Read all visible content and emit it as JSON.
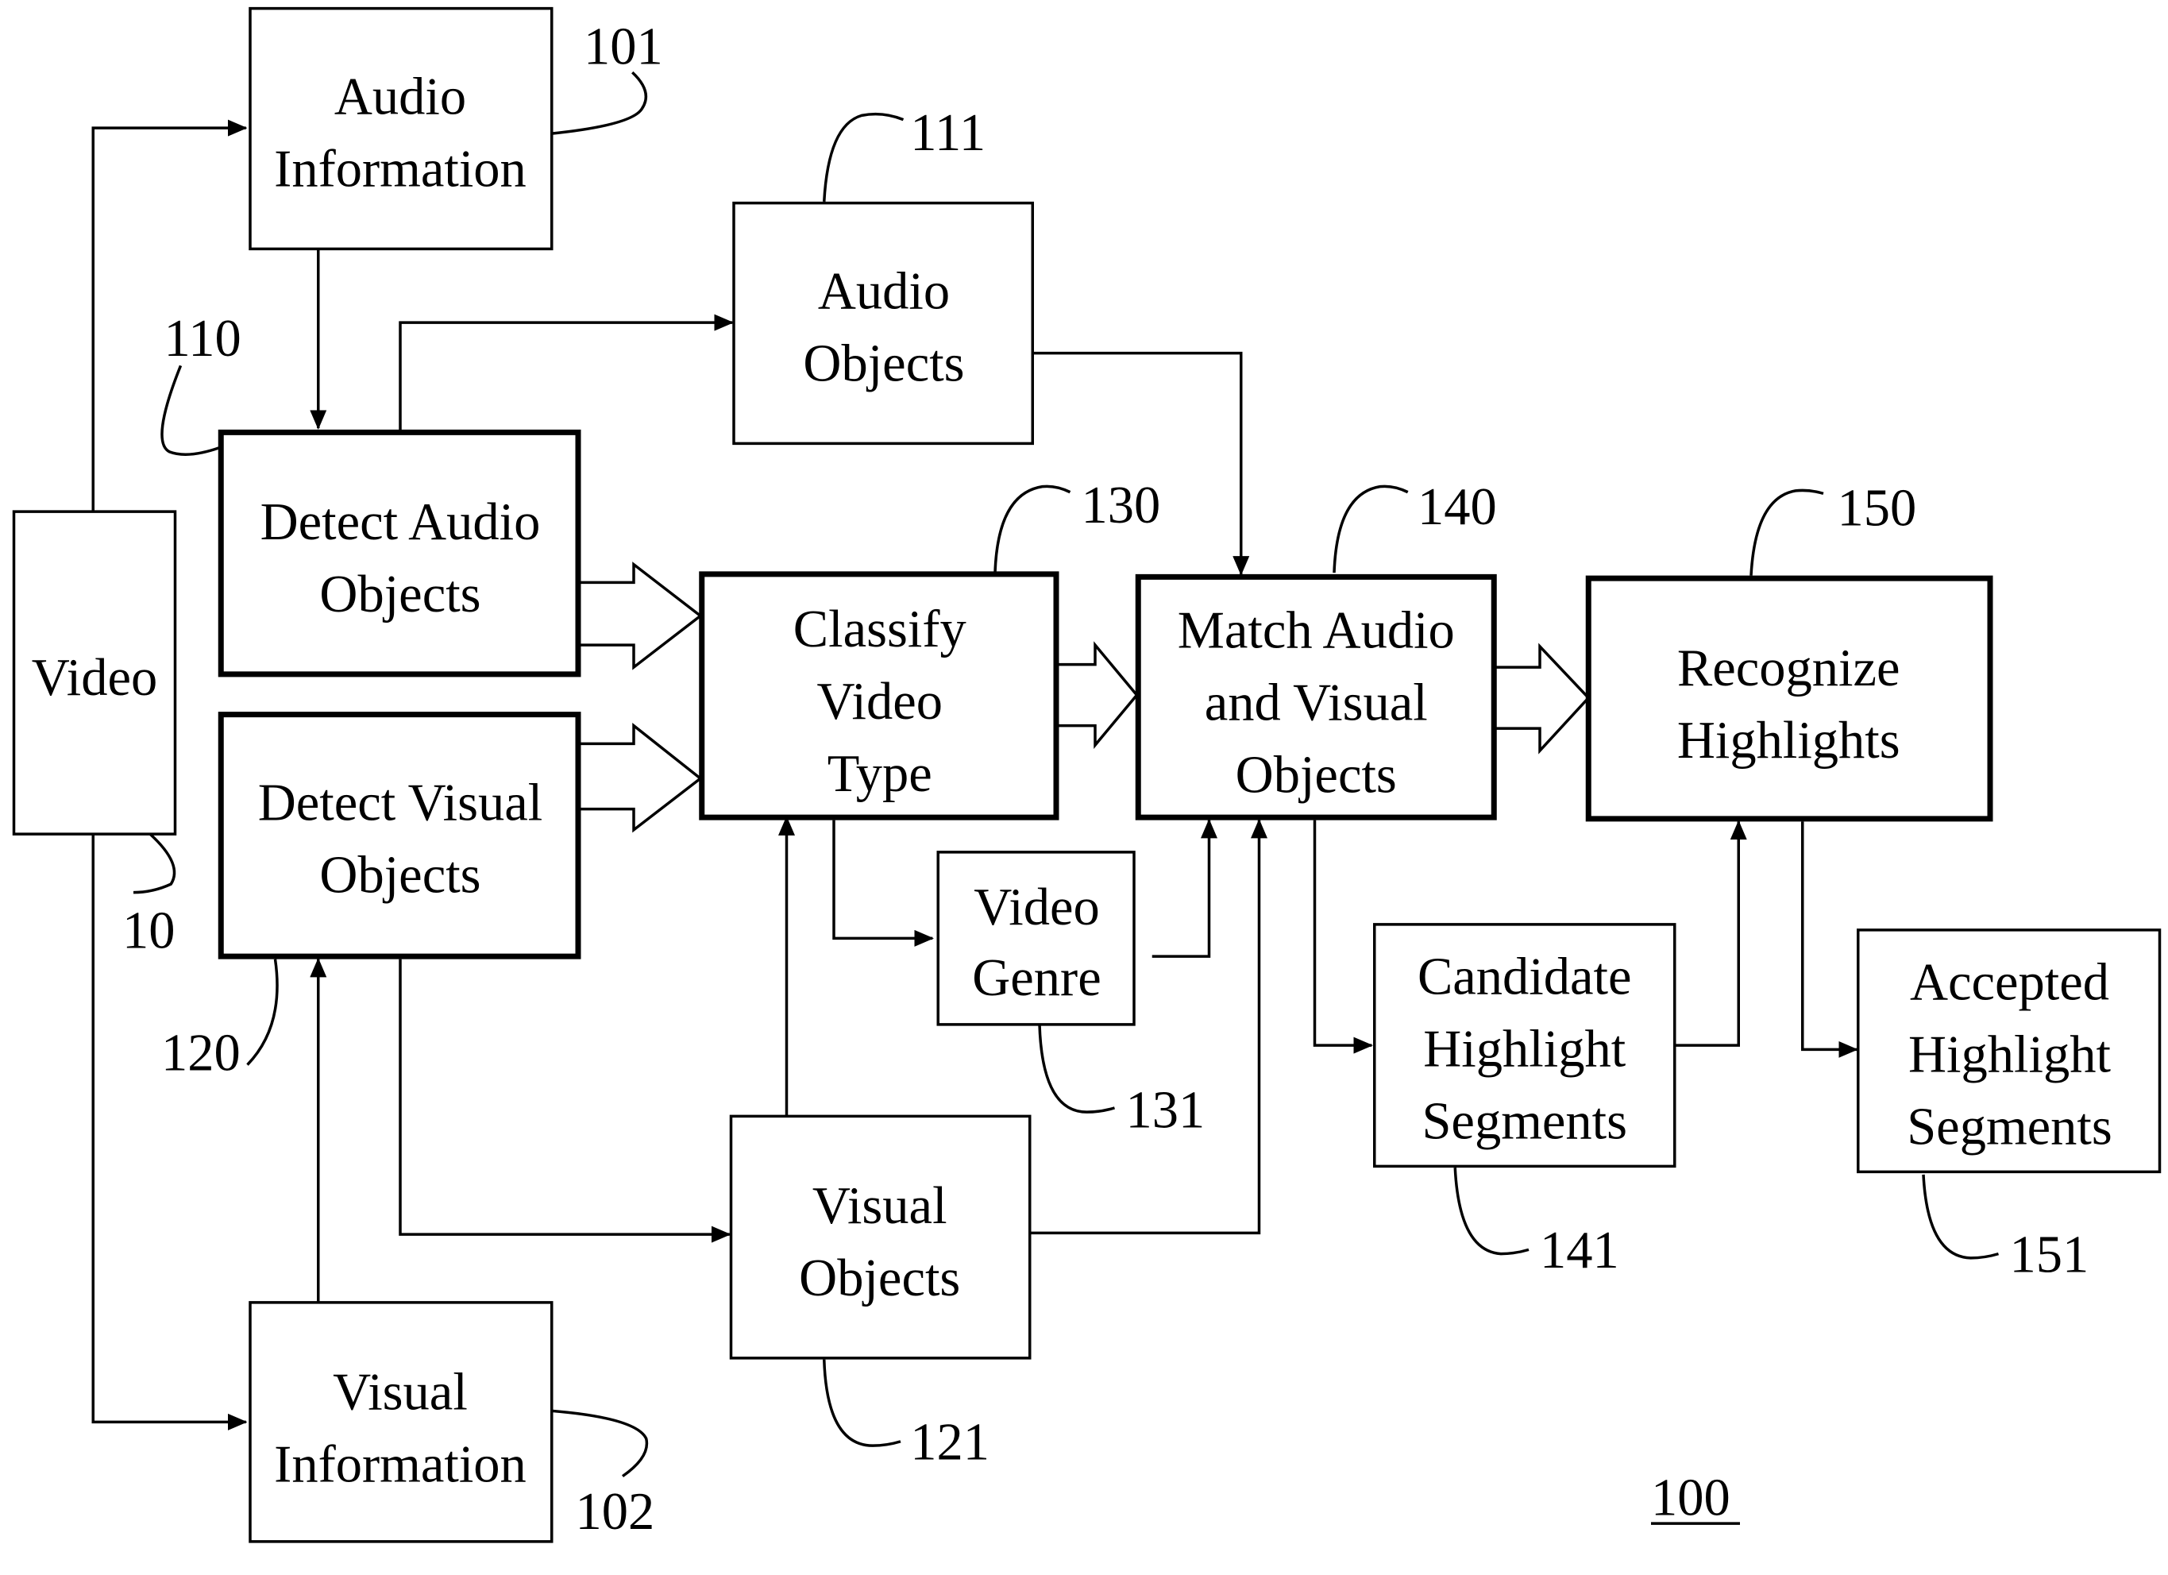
{
  "figure_number": "100",
  "nodes": {
    "video": {
      "lines": [
        "Video"
      ],
      "ref": "10"
    },
    "audio_information": {
      "lines": [
        "Audio",
        "Information"
      ],
      "ref": "101"
    },
    "visual_information": {
      "lines": [
        "Visual",
        "Information"
      ],
      "ref": "102"
    },
    "detect_audio_objects": {
      "lines": [
        "Detect Audio",
        "Objects"
      ],
      "ref": "110"
    },
    "audio_objects": {
      "lines": [
        "Audio",
        "Objects"
      ],
      "ref": "111"
    },
    "detect_visual_objects": {
      "lines": [
        "Detect Visual",
        "Objects"
      ],
      "ref": "120"
    },
    "visual_objects": {
      "lines": [
        "Visual",
        "Objects"
      ],
      "ref": "121"
    },
    "classify_video_type": {
      "lines": [
        "Classify",
        "Video",
        "Type"
      ],
      "ref": "130"
    },
    "video_genre": {
      "lines": [
        "Video",
        "Genre"
      ],
      "ref": "131"
    },
    "match_audio_visual": {
      "lines": [
        "Match Audio",
        "and Visual",
        "Objects"
      ],
      "ref": "140"
    },
    "candidate_segments": {
      "lines": [
        "Candidate",
        "Highlight",
        "Segments"
      ],
      "ref": "141"
    },
    "recognize_highlights": {
      "lines": [
        "Recognize",
        "Highlights"
      ],
      "ref": "150"
    },
    "accepted_segments": {
      "lines": [
        "Accepted",
        "Highlight",
        "Segments"
      ],
      "ref": "151"
    }
  },
  "edges": [
    {
      "from": "video",
      "to": "audio_information",
      "style": "line-arrow"
    },
    {
      "from": "video",
      "to": "visual_information",
      "style": "line-arrow"
    },
    {
      "from": "audio_information",
      "to": "detect_audio_objects",
      "style": "line-arrow"
    },
    {
      "from": "visual_information",
      "to": "detect_visual_objects",
      "style": "line-arrow"
    },
    {
      "from": "detect_audio_objects",
      "to": "audio_objects",
      "style": "line-arrow"
    },
    {
      "from": "detect_visual_objects",
      "to": "visual_objects",
      "style": "line-arrow"
    },
    {
      "from": "detect_audio_objects",
      "to": "classify_video_type",
      "style": "block-arrow"
    },
    {
      "from": "detect_visual_objects",
      "to": "classify_video_type",
      "style": "block-arrow"
    },
    {
      "from": "visual_objects",
      "to": "classify_video_type",
      "style": "line-arrow"
    },
    {
      "from": "classify_video_type",
      "to": "video_genre",
      "style": "line-arrow"
    },
    {
      "from": "classify_video_type",
      "to": "match_audio_visual",
      "style": "block-arrow"
    },
    {
      "from": "audio_objects",
      "to": "match_audio_visual",
      "style": "line-arrow"
    },
    {
      "from": "video_genre",
      "to": "match_audio_visual",
      "style": "line-arrow"
    },
    {
      "from": "visual_objects",
      "to": "match_audio_visual",
      "style": "line-arrow"
    },
    {
      "from": "match_audio_visual",
      "to": "candidate_segments",
      "style": "line-arrow"
    },
    {
      "from": "match_audio_visual",
      "to": "recognize_highlights",
      "style": "block-arrow"
    },
    {
      "from": "candidate_segments",
      "to": "recognize_highlights",
      "style": "line-arrow"
    },
    {
      "from": "recognize_highlights",
      "to": "accepted_segments",
      "style": "line-arrow"
    }
  ]
}
